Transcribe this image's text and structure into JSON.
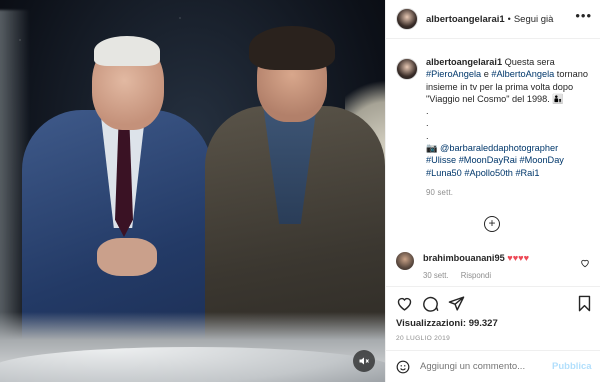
{
  "post": {
    "username": "albertoangelarai1",
    "separator": "•",
    "follow_status": "Segui già",
    "more_symbol": "•••"
  },
  "caption": {
    "username": "albertoangelarai1",
    "text_1": "Questa sera",
    "tag_1": "#PieroAngela",
    "text_2": " e ",
    "tag_2": "#AlbertoAngela",
    "text_3": " tornano insieme in tv per la prima volta dopo \"Viaggio nel Cosmo\" del 1998. 👨‍👦",
    "dots": ".",
    "credit_icon": "📷",
    "credit_tag": "@barbaraleddaphotographer",
    "tags_line": [
      "#Ulisse",
      "#MoonDayRai",
      "#MoonDay",
      "#Luna50",
      "#Apollo50th",
      "#Rai1"
    ],
    "time": "90 sett."
  },
  "comment": {
    "username": "brahimbouanani95",
    "text": "♥♥♥♥",
    "time": "30 sett.",
    "reply": "Rispondi"
  },
  "stats": {
    "views_label": "Visualizzazioni:",
    "views_value": "99.327",
    "date": "20 LUGLIO 2019"
  },
  "add_comment": {
    "placeholder": "Aggiungi un commento...",
    "publish": "Pubblica"
  },
  "colors": {
    "link": "#00376b",
    "muted": "#8e8e8e",
    "heart": "#ed4956",
    "publish_disabled": "#b2dffc"
  },
  "icons": {
    "media_mute": "speaker-muted-icon",
    "like": "heart-icon",
    "comment": "comment-icon",
    "share": "paper-plane-icon",
    "save": "bookmark-icon",
    "load_more": "plus-circle-icon",
    "emoji": "smiley-icon"
  }
}
